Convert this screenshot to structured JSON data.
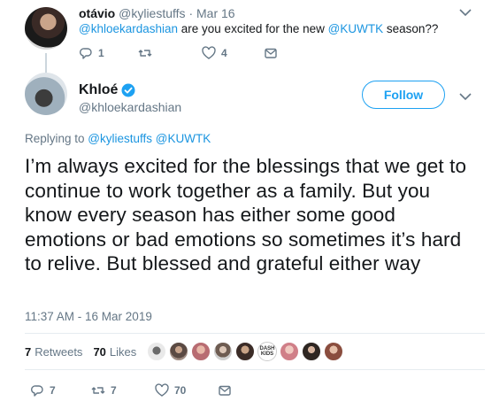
{
  "parent_tweet": {
    "name": "otávio",
    "handle": "@kyliestuffs",
    "separator": "·",
    "date": "Mar 16",
    "text_mention": "@khloekardashian",
    "text_middle": " are you excited for the new ",
    "text_hashtag": "@KUWTK",
    "text_end": " season??",
    "actions": {
      "reply_count": "1",
      "retweet_count": "",
      "like_count": "4"
    }
  },
  "main_tweet": {
    "name": "Khloé",
    "handle": "@khloekardashian",
    "follow_label": "Follow",
    "replying_prefix": "Replying to ",
    "replying_to": "@kyliestuffs @KUWTK",
    "text": "I’m always excited for the blessings that we get to continue to work together as a family. But you know every season has either some good emotions or bad emotions so sometimes it’s hard to relive. But blessed and grateful either way",
    "timestamp": "11:37 AM - 16 Mar 2019",
    "stats": {
      "retweets_count": "7",
      "retweets_label": "Retweets",
      "likes_count": "70",
      "likes_label": "Likes"
    },
    "liker_badge_text": "DASH KIDS",
    "actions": {
      "reply_count": "7",
      "retweet_count": "7",
      "like_count": "70"
    }
  },
  "icons": {
    "chevron": "chevron-down-icon",
    "verified": "verified-badge-icon",
    "reply": "reply-icon",
    "retweet": "retweet-icon",
    "like": "heart-icon",
    "message": "direct-message-icon"
  },
  "colors": {
    "accent": "#1da1f2",
    "link": "#1b95e0",
    "muted": "#657786",
    "text": "#14171a"
  }
}
